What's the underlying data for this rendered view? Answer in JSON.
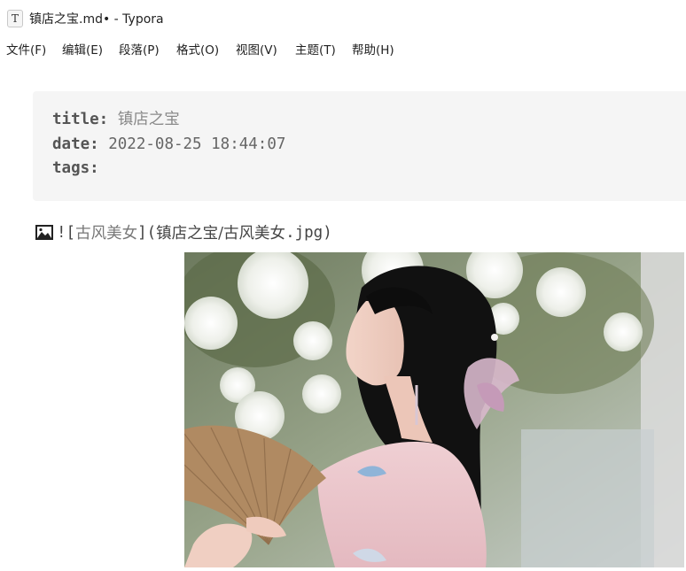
{
  "window": {
    "app_icon_letter": "T",
    "title": "镇店之宝.md• - Typora"
  },
  "menu": [
    "文件(F)",
    "编辑(E)",
    "段落(P)",
    "格式(O)",
    "视图(V)",
    "主题(T)",
    "帮助(H)"
  ],
  "front_matter": {
    "title_key": "title:",
    "title_value": "镇店之宝",
    "date_key": "date:",
    "date_value": "2022-08-25 18:44:07",
    "tags_key": "tags:"
  },
  "image_markdown": {
    "icon": "picture-icon",
    "prefix": "![",
    "alt": "古风美女",
    "middle": "](",
    "path": "镇店之宝/古风美女",
    "ext": ".jpg",
    "suffix": ")"
  },
  "colors": {
    "front_matter_bg": "#f5f5f5",
    "text": "#222222"
  }
}
